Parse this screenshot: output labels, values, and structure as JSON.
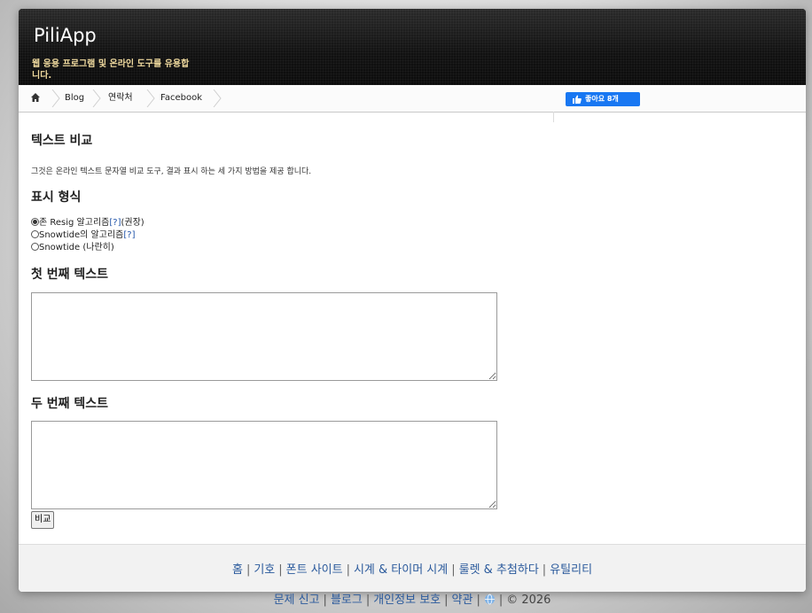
{
  "header": {
    "logo": "PiliApp",
    "tagline": "웹 응용 프로그램 및 온라인 도구를 유용합니다."
  },
  "nav": {
    "items": [
      {
        "label": "Blog"
      },
      {
        "label": "연락처"
      },
      {
        "label": "Facebook"
      }
    ],
    "like_label": "좋아요 8개",
    "colors": {
      "like": "#1877f2"
    }
  },
  "main": {
    "title": "텍스트 비교",
    "description": "그것은 온라인 텍스트 문자열 비교 도구, 결과 표시 하는 세 가지 방법을 제공 합니다.",
    "format_heading": "표시 형식",
    "options": [
      {
        "label": "존 Resig 알고리즘",
        "link": "[?]",
        "suffix": "(권장)",
        "checked": true
      },
      {
        "label": "Snowtide의 알고리즘",
        "link": "[?]",
        "suffix": "",
        "checked": false
      },
      {
        "label": "Snowtide (나란히)",
        "link": "",
        "suffix": "",
        "checked": false
      }
    ],
    "first_heading": "첫 번째 텍스트",
    "first_value": "",
    "second_heading": "두 번째 텍스트",
    "second_value": "",
    "compare_label": "비교"
  },
  "footer": {
    "row1": [
      "홈",
      "기호",
      "폰트 사이트",
      "시계 & 타이머 시계",
      "룰렛 & 추첨하다",
      "유틸리티"
    ],
    "row2": [
      "문제 신고",
      "블로그",
      "개인정보 보호",
      "약관"
    ],
    "copyright": "© 2026",
    "globe_icon": "globe-icon"
  }
}
